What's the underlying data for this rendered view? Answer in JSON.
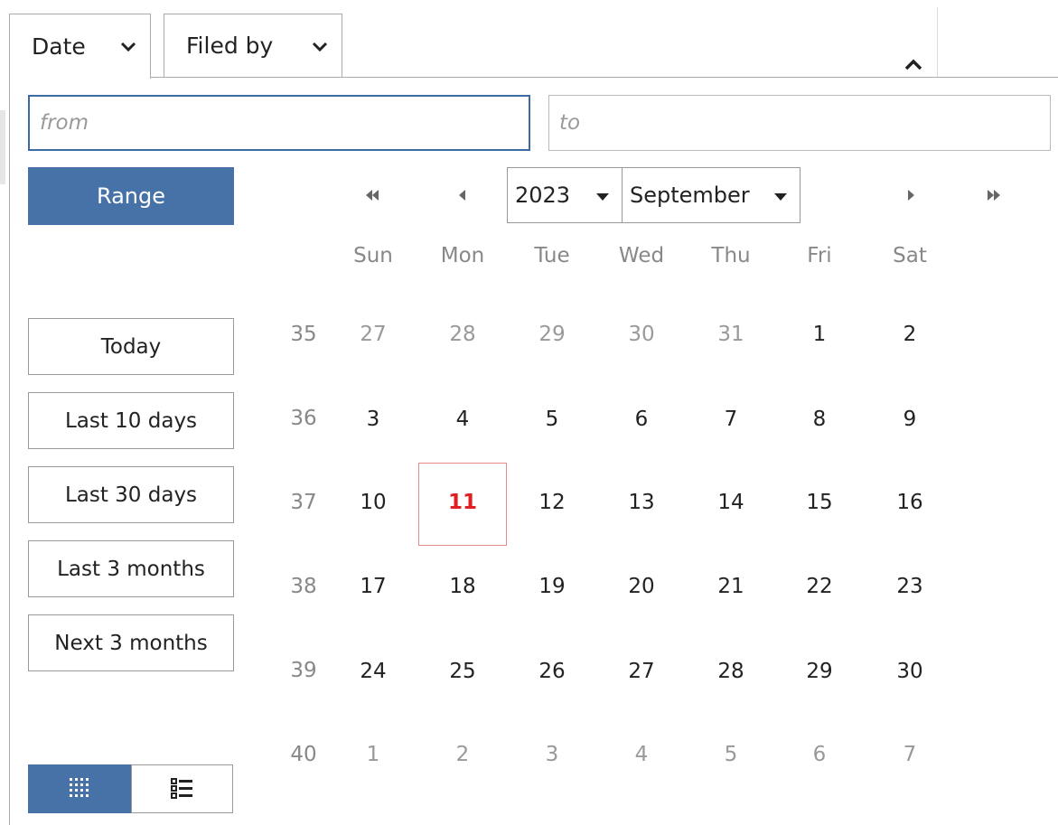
{
  "tabs": [
    {
      "label": "Date"
    },
    {
      "label": "Filed by"
    }
  ],
  "inputs": {
    "from_placeholder": "from",
    "to_placeholder": "to"
  },
  "buttons": {
    "range": "Range",
    "today": "Today",
    "last10": "Last 10 days",
    "last30": "Last 30 days",
    "last3m": "Last 3 months",
    "next3m": "Next 3 months"
  },
  "calendar": {
    "year": "2023",
    "month": "September",
    "weekdays": [
      "Sun",
      "Mon",
      "Tue",
      "Wed",
      "Thu",
      "Fri",
      "Sat"
    ],
    "weeks": [
      {
        "num": "35",
        "days": [
          "27",
          "28",
          "29",
          "30",
          "31",
          "1",
          "2"
        ]
      },
      {
        "num": "36",
        "days": [
          "3",
          "4",
          "5",
          "6",
          "7",
          "8",
          "9"
        ]
      },
      {
        "num": "37",
        "days": [
          "10",
          "11",
          "12",
          "13",
          "14",
          "15",
          "16"
        ]
      },
      {
        "num": "38",
        "days": [
          "17",
          "18",
          "19",
          "20",
          "21",
          "22",
          "23"
        ]
      },
      {
        "num": "39",
        "days": [
          "24",
          "25",
          "26",
          "27",
          "28",
          "29",
          "30"
        ]
      },
      {
        "num": "40",
        "days": [
          "1",
          "2",
          "3",
          "4",
          "5",
          "6",
          "7"
        ]
      }
    ],
    "today": "11"
  },
  "colors": {
    "accent": "#4772a8",
    "today": "#e02020"
  }
}
